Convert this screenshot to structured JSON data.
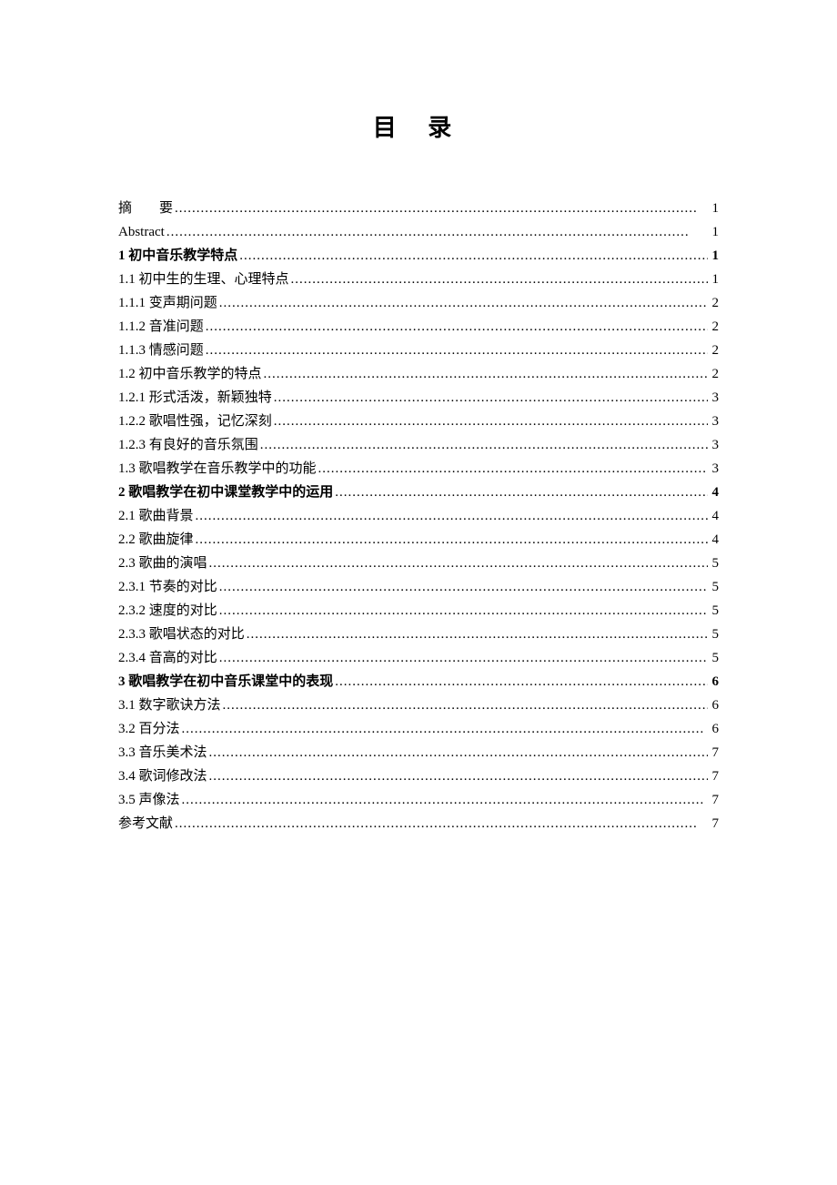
{
  "title": "目 录",
  "entries": [
    {
      "label": "摘　　要",
      "page": "1",
      "bold": false
    },
    {
      "label": "Abstract",
      "page": "1",
      "bold": false
    },
    {
      "label": "1 初中音乐教学特点",
      "page": "1",
      "bold": true
    },
    {
      "label": "1.1 初中生的生理、心理特点",
      "page": "1",
      "bold": false
    },
    {
      "label": "1.1.1 变声期问题",
      "page": "2",
      "bold": false
    },
    {
      "label": "1.1.2 音准问题",
      "page": "2",
      "bold": false
    },
    {
      "label": "1.1.3 情感问题",
      "page": "2",
      "bold": false
    },
    {
      "label": "1.2 初中音乐教学的特点",
      "page": "2",
      "bold": false
    },
    {
      "label": "1.2.1 形式活泼，新颖独特 ",
      "page": "3",
      "bold": false
    },
    {
      "label": "1.2.2 歌唱性强，记忆深刻",
      "page": "3",
      "bold": false
    },
    {
      "label": "1.2.3 有良好的音乐氛围",
      "page": "3",
      "bold": false
    },
    {
      "label": "1.3 歌唱教学在音乐教学中的功能",
      "page": "3",
      "bold": false
    },
    {
      "label": "2 歌唱教学在初中课堂教学中的运用",
      "page": "4",
      "bold": true
    },
    {
      "label": "2.1 歌曲背景 ",
      "page": "4",
      "bold": false
    },
    {
      "label": "2.2 歌曲旋律",
      "page": "4",
      "bold": false
    },
    {
      "label": "2.3 歌曲的演唱",
      "page": "5",
      "bold": false
    },
    {
      "label": "2.3.1 节奏的对比",
      "page": "5",
      "bold": false
    },
    {
      "label": "2.3.2 速度的对比 ",
      "page": "5",
      "bold": false
    },
    {
      "label": "2.3.3 歌唱状态的对比 ",
      "page": "5",
      "bold": false
    },
    {
      "label": "2.3.4 音高的对比 ",
      "page": "5",
      "bold": false
    },
    {
      "label": "3 歌唱教学在初中音乐课堂中的表现",
      "page": "6",
      "bold": true
    },
    {
      "label": "3.1 数字歌诀方法",
      "page": "6",
      "bold": false
    },
    {
      "label": "3.2 百分法",
      "page": "6",
      "bold": false
    },
    {
      "label": "3.3 音乐美术法",
      "page": "7",
      "bold": false
    },
    {
      "label": "3.4 歌词修改法",
      "page": "7",
      "bold": false
    },
    {
      "label": "3.5 声像法",
      "page": "7",
      "bold": false
    },
    {
      "label": "参考文献",
      "page": "7",
      "bold": false
    }
  ]
}
